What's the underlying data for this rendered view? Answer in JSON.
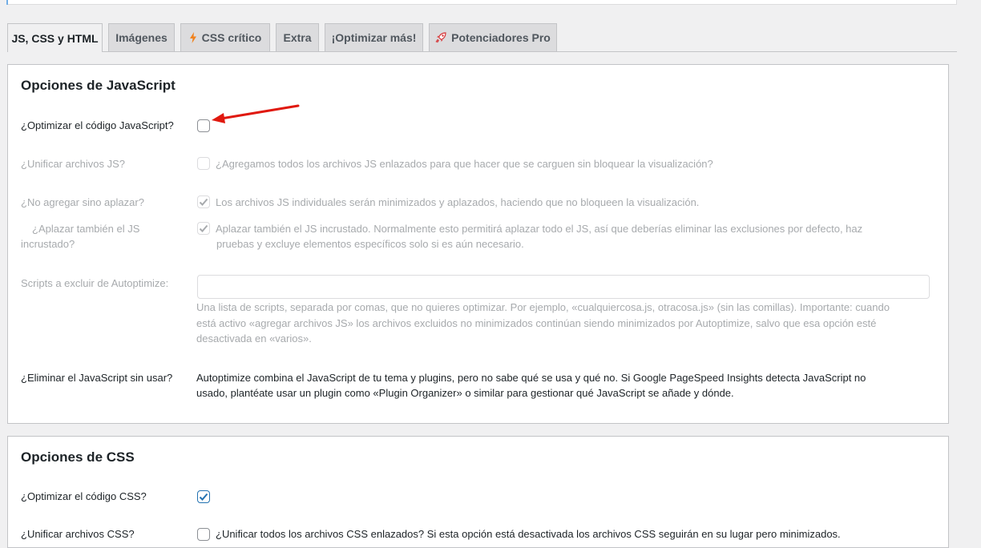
{
  "tabs": [
    {
      "label": "JS, CSS y HTML",
      "active": true
    },
    {
      "label": "Imágenes"
    },
    {
      "label": "CSS crítico",
      "icon": "lightning-icon"
    },
    {
      "label": "Extra"
    },
    {
      "label": "¡Optimizar más!"
    },
    {
      "label": "Potenciadores Pro",
      "icon": "rocket-icon"
    }
  ],
  "js": {
    "title": "Opciones de JavaScript",
    "optimize": {
      "label": "¿Optimizar el código JavaScript?",
      "checked": false
    },
    "aggregate": {
      "label": "¿Unificar archivos JS?",
      "desc": "¿Agregamos todos los archivos JS enlazados para que hacer que se carguen sin bloquear la visualización?",
      "checked": false
    },
    "defer_only": {
      "label": "¿No agregar sino aplazar?",
      "desc": "Los archivos JS individuales serán minimizados y aplazados, haciendo que no bloqueen la visualización.",
      "checked": true
    },
    "defer_inline": {
      "label1": "¿Aplazar también el JS",
      "label2": "incrustado?",
      "desc1": "Aplazar también el JS incrustado. Normalmente esto permitirá aplazar todo el JS, así que deberías eliminar las exclusiones por defecto, haz",
      "desc2": "pruebas y excluye elementos específicos solo si es aún necesario.",
      "checked": true
    },
    "exclude": {
      "label": "Scripts a excluir de Autoptimize:",
      "value": "",
      "desc1": "Una lista de scripts, separada por comas, que no quieres optimizar. Por ejemplo, «cualquiercosa.js, otracosa.js» (sin las comillas). Importante: cuando",
      "desc2": "está activo «agregar archivos JS» los archivos excluidos no minimizados continúan siendo minimizados por Autoptimize, salvo que esa opción esté",
      "desc3": "desactivada en «varios»."
    },
    "unused": {
      "label": "¿Eliminar el JavaScript sin usar?",
      "desc1": "Autoptimize combina el JavaScript de tu tema y plugins, pero no sabe qué se usa y qué no. Si Google PageSpeed Insights detecta JavaScript no",
      "desc2": "usado, plantéate usar un plugin como «Plugin Organizer» o similar para gestionar qué JavaScript se añade y dónde."
    }
  },
  "css": {
    "title": "Opciones de CSS",
    "optimize": {
      "label": "¿Optimizar el código CSS?",
      "checked": true
    },
    "aggregate": {
      "label": "¿Unificar archivos CSS?",
      "desc": "¿Unificar todos los archivos CSS enlazados? Si esta opción está desactivada los archivos CSS seguirán en su lugar pero minimizados."
    }
  },
  "colors": {
    "accent": "#2271b1",
    "arrow": "#e0190f",
    "lightning": "#f0821e",
    "rocket": "#d63638"
  }
}
